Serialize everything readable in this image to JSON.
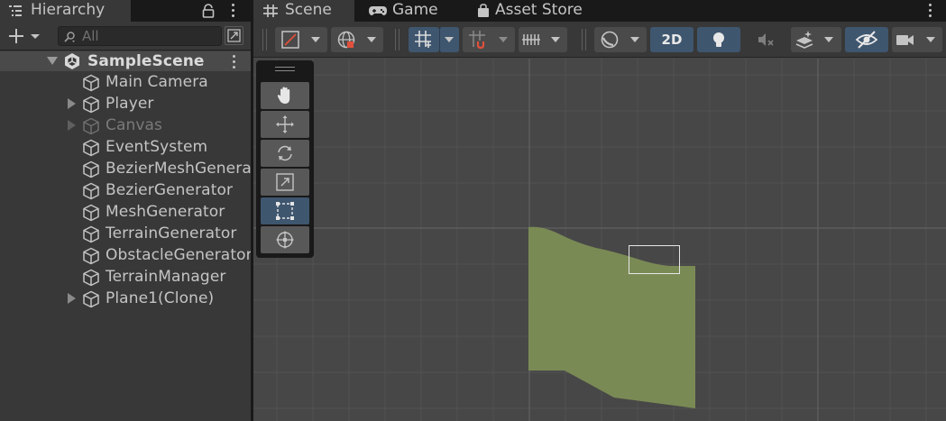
{
  "hierarchy": {
    "tab_label": "Hierarchy",
    "tab_icon": "hierarchy-list-icon",
    "search_placeholder": "All",
    "items": [
      {
        "label": "SampleScene",
        "type": "scene",
        "expanded": true
      },
      {
        "label": "Main Camera",
        "type": "gameobject",
        "has_children": false
      },
      {
        "label": "Player",
        "type": "gameobject",
        "has_children": true
      },
      {
        "label": "Canvas",
        "type": "gameobject",
        "has_children": true,
        "inactive": true
      },
      {
        "label": "EventSystem",
        "type": "gameobject",
        "has_children": false
      },
      {
        "label": "BezierMeshGenerator",
        "type": "gameobject",
        "has_children": false
      },
      {
        "label": "BezierGenerator",
        "type": "gameobject",
        "has_children": false
      },
      {
        "label": "MeshGenerator",
        "type": "gameobject",
        "has_children": false
      },
      {
        "label": "TerrainGenerator",
        "type": "gameobject",
        "has_children": false
      },
      {
        "label": "ObstacleGenerator",
        "type": "gameobject",
        "has_children": false
      },
      {
        "label": "TerrainManager",
        "type": "gameobject",
        "has_children": false
      },
      {
        "label": "Plane1(Clone)",
        "type": "gameobject",
        "has_children": true
      }
    ]
  },
  "tabs": [
    {
      "label": "Scene",
      "icon": "grid-hash-icon",
      "active": true
    },
    {
      "label": "Game",
      "icon": "gamepad-icon",
      "active": false
    },
    {
      "label": "Asset Store",
      "icon": "shopping-bag-icon",
      "active": false
    }
  ],
  "scene_toolbar": {
    "two_d_label": "2D"
  },
  "colors": {
    "selected": "#3f566f",
    "mesh": "#7a8a55",
    "panel": "#383838",
    "viewport": "#474747"
  }
}
